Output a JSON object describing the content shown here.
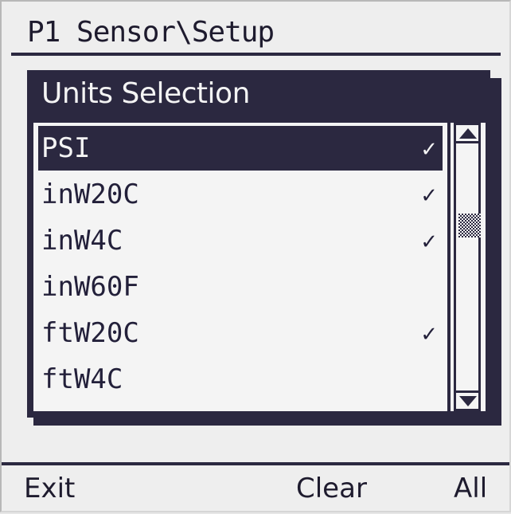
{
  "header": {
    "title": "P1 Sensor\\Setup"
  },
  "dialog": {
    "title": "Units Selection",
    "items": [
      {
        "label": "PSI",
        "check": "✓",
        "selected": true
      },
      {
        "label": "inW20C",
        "check": "✓",
        "selected": false
      },
      {
        "label": "inW4C",
        "check": "✓",
        "selected": false
      },
      {
        "label": "inW60F",
        "check": "",
        "selected": false
      },
      {
        "label": "ftW20C",
        "check": "✓",
        "selected": false
      },
      {
        "label": "ftW4C",
        "check": "",
        "selected": false
      }
    ],
    "scrollbar": {
      "up_icon": "scroll-up-arrow",
      "down_icon": "scroll-down-arrow"
    }
  },
  "softkeys": {
    "left": "Exit",
    "middle": "Clear",
    "right": "All"
  },
  "colors": {
    "ink": "#2b2840",
    "background": "#f4f4f4"
  }
}
